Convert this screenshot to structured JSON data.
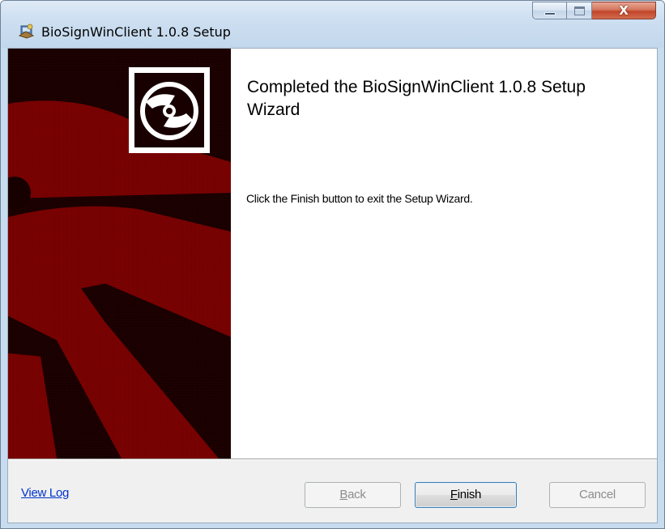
{
  "window": {
    "title": "BioSignWinClient 1.0.8 Setup",
    "icons": {
      "app": "installer-icon",
      "minimize": "minimize-icon",
      "maximize": "maximize-icon",
      "close": "close-icon"
    },
    "close_glyph": "X"
  },
  "content": {
    "heading": "Completed the BioSignWinClient 1.0.8 Setup Wizard",
    "description": "Click the Finish button to exit the Setup Wizard."
  },
  "banner": {
    "icon": "cd-icon",
    "colors": {
      "dark": "#1c0000",
      "red": "#7a0000"
    }
  },
  "footer": {
    "view_log": "View Log",
    "back": {
      "mnemonic": "B",
      "rest": "ack",
      "enabled": false
    },
    "finish": {
      "mnemonic": "F",
      "rest": "inish",
      "enabled": true,
      "default": true
    },
    "cancel": {
      "label": "Cancel",
      "enabled": false
    }
  }
}
